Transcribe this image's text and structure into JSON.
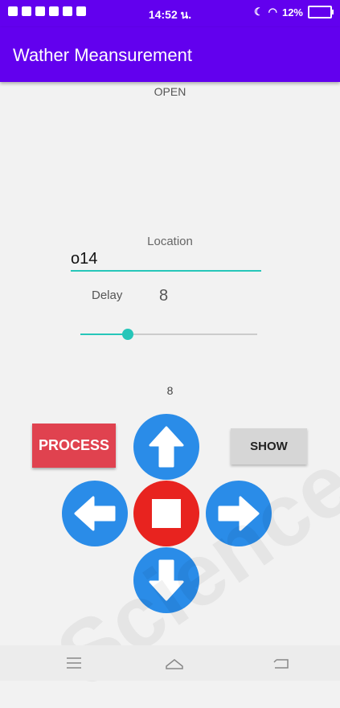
{
  "status_bar": {
    "time": "14:52 น.",
    "battery": "12%",
    "icons": [
      "sim-icon",
      "gallery-icon",
      "cloud-icon",
      "mail-icon",
      "mail-icon",
      "youtube-icon"
    ]
  },
  "app_bar": {
    "title": "Wather Meansurement"
  },
  "main": {
    "status_text": "OPEN",
    "location_label": "Location",
    "location_value": "o14",
    "delay_label": "Delay",
    "delay_value": "8",
    "slider": {
      "value": 8,
      "max": 30,
      "value_text": "8"
    },
    "process_label": "PROCESS",
    "show_label": "SHOW"
  },
  "colors": {
    "primary": "#6200ee",
    "accent": "#26c6b9",
    "dpad_blue": "#2a8ce8",
    "stop_red": "#e8231f",
    "process_red": "#e0424f"
  },
  "watermark": "Science Depa Mahasarak"
}
